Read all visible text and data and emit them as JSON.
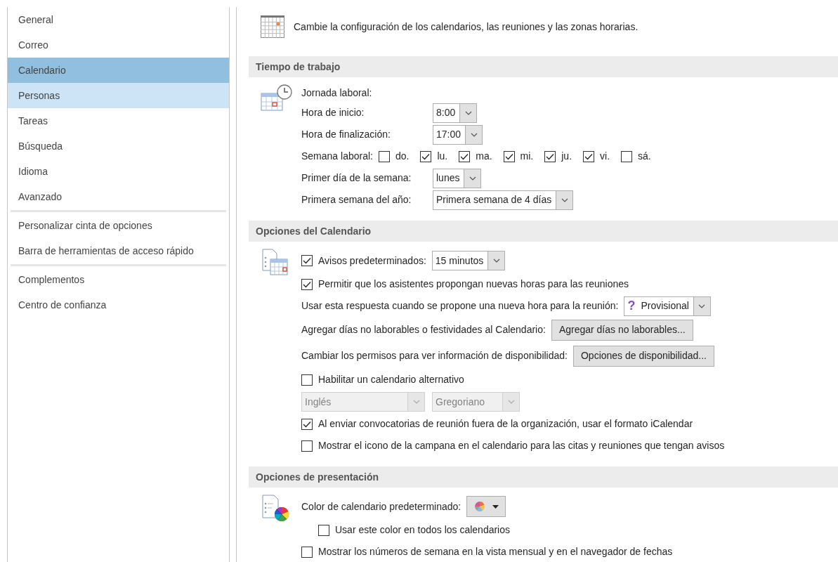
{
  "sidebar": {
    "groups": [
      [
        {
          "label": "General",
          "selected": false,
          "highlighted": false
        },
        {
          "label": "Correo",
          "selected": false,
          "highlighted": false
        },
        {
          "label": "Calendario",
          "selected": true,
          "highlighted": false
        },
        {
          "label": "Personas",
          "selected": false,
          "highlighted": true
        },
        {
          "label": "Tareas",
          "selected": false,
          "highlighted": false
        },
        {
          "label": "Búsqueda",
          "selected": false,
          "highlighted": false
        },
        {
          "label": "Idioma",
          "selected": false,
          "highlighted": false
        },
        {
          "label": "Avanzado",
          "selected": false,
          "highlighted": false
        }
      ],
      [
        {
          "label": "Personalizar cinta de opciones",
          "selected": false,
          "highlighted": false
        },
        {
          "label": "Barra de herramientas de acceso rápido",
          "selected": false,
          "highlighted": false
        }
      ],
      [
        {
          "label": "Complementos",
          "selected": false,
          "highlighted": false
        },
        {
          "label": "Centro de confianza",
          "selected": false,
          "highlighted": false
        }
      ]
    ]
  },
  "header": {
    "text": "Cambie la configuración de los calendarios, las reuniones y las zonas horarias."
  },
  "sections": [
    {
      "title": "Tiempo de trabajo",
      "rows": [
        {
          "kind": "label",
          "label": "Jornada laboral:"
        },
        {
          "kind": "select",
          "label": "Hora de inicio:",
          "value": "8:00"
        },
        {
          "kind": "select",
          "label": "Hora de finalización:",
          "value": "17:00"
        },
        {
          "kind": "days",
          "label": "Semana laboral:",
          "days": [
            {
              "label": "do.",
              "checked": false
            },
            {
              "label": "lu.",
              "checked": true
            },
            {
              "label": "ma.",
              "checked": true
            },
            {
              "label": "mi.",
              "checked": true
            },
            {
              "label": "ju.",
              "checked": true
            },
            {
              "label": "vi.",
              "checked": true
            },
            {
              "label": "sá.",
              "checked": false
            }
          ]
        },
        {
          "kind": "select",
          "label": "Primer día de la semana:",
          "value": "lunes"
        },
        {
          "kind": "select",
          "label": "Primera semana del año:",
          "value": "Primera semana de 4 días"
        }
      ]
    },
    {
      "title": "Opciones del Calendario",
      "rows": [
        {
          "kind": "checkbox-select",
          "label": "Avisos predeterminados:",
          "checked": true,
          "value": "15 minutos"
        },
        {
          "kind": "checkbox",
          "label": "Permitir que los asistentes propongan nuevas horas para las reuniones",
          "checked": true
        },
        {
          "kind": "select",
          "label": "Usar esta respuesta cuando se propone una nueva hora para la reunión:",
          "symbol": "?",
          "value": "Provisional"
        },
        {
          "kind": "button",
          "label": "Agregar días no laborables o festividades al Calendario:",
          "button": "Agregar días no laborables..."
        },
        {
          "kind": "button",
          "label": "Cambiar los permisos para ver información de disponibilidad:",
          "button": "Opciones de disponibilidad..."
        },
        {
          "kind": "checkbox",
          "label": "Habilitar un calendario alternativo",
          "checked": false
        },
        {
          "kind": "select-pair",
          "selects": [
            {
              "value": "Inglés",
              "disabled": true
            },
            {
              "value": "Gregoriano",
              "disabled": true
            }
          ]
        },
        {
          "kind": "checkbox",
          "label": "Al enviar convocatorias de reunión fuera de la organización, usar el formato iCalendar",
          "checked": true
        },
        {
          "kind": "checkbox",
          "label": "Mostrar el icono de la campana en el calendario para las citas y reuniones que tengan avisos",
          "checked": false
        }
      ]
    },
    {
      "title": "Opciones de presentación",
      "rows": [
        {
          "kind": "color",
          "label": "Color de calendario predeterminado:"
        },
        {
          "kind": "sub-checkbox",
          "label": "Usar este color en todos los calendarios",
          "checked": false
        },
        {
          "kind": "checkbox",
          "label": "Mostrar los números de semana en la vista mensual y en el navegador de fechas",
          "checked": false
        }
      ]
    }
  ]
}
